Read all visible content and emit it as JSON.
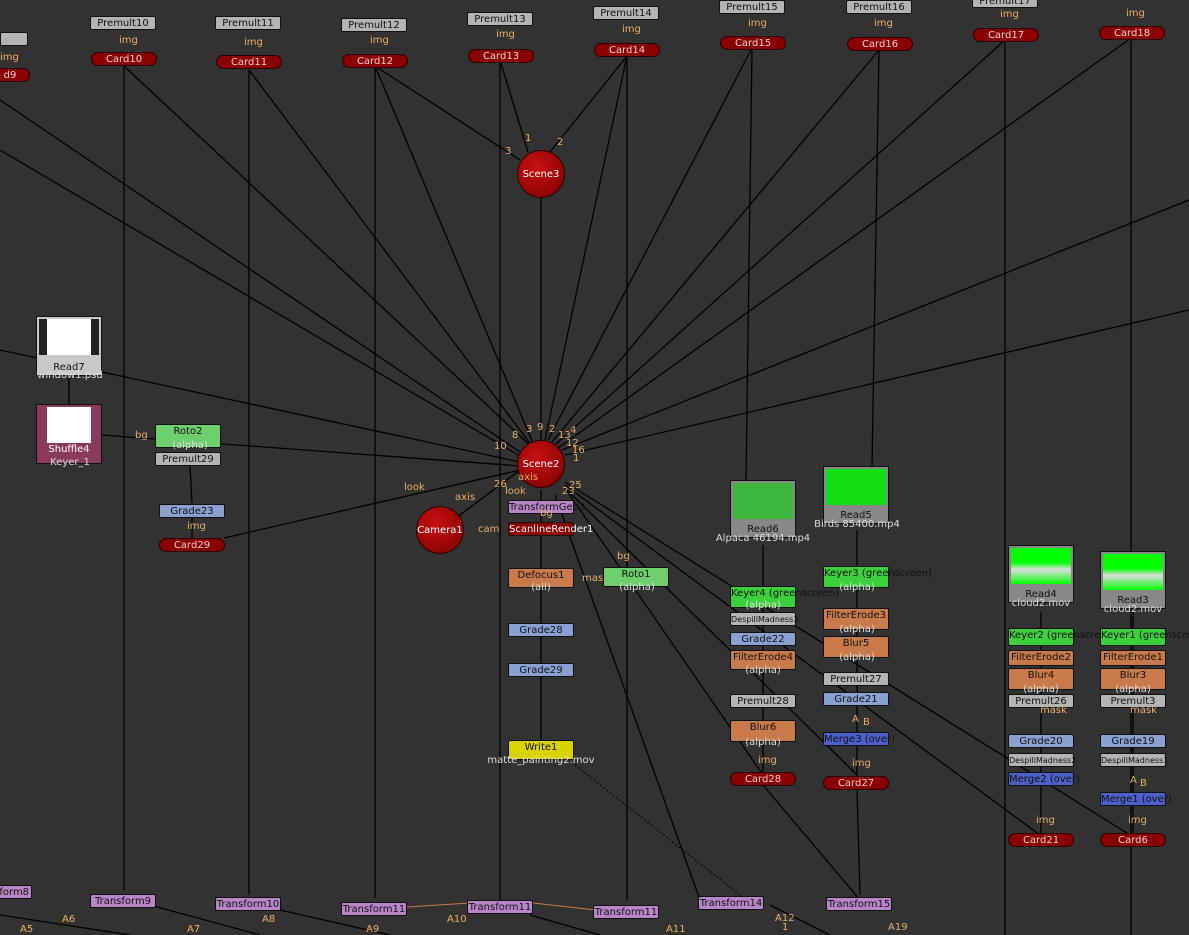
{
  "colors": {
    "background": "#323232",
    "card": "#8b0000",
    "premult": "#b4b4b4",
    "keyer": "#3cd13c",
    "filter": "#c97a4a",
    "grade": "#8aa0d0",
    "merge": "#4d5fc8",
    "transform": "#b886c8",
    "write": "#d9d400",
    "labels": "#e8b060"
  },
  "premults": [
    "Premult10",
    "Premult11",
    "Premult12",
    "Premult13",
    "Premult14",
    "Premult15",
    "Premult16",
    "Premult17"
  ],
  "img_label": "img",
  "cards": [
    "Card10",
    "Card11",
    "Card12",
    "Card13",
    "Card14",
    "Card15",
    "Card16",
    "Card17",
    "Card18",
    "Card29",
    "Card28",
    "Card27",
    "Card21",
    "Card6",
    "d9"
  ],
  "scenes": {
    "scene3": "Scene3",
    "scene2": "Scene2",
    "camera": "Camera1"
  },
  "scene3_inputs": [
    "1",
    "2",
    "3"
  ],
  "scene2_inputs": [
    "10",
    "8",
    "3",
    "9",
    "2",
    "13",
    "12",
    "4",
    "16",
    "1",
    "26",
    "23",
    "25"
  ],
  "left": {
    "read7": "Read7",
    "read7_file": "window1.psd",
    "shuffle": "Shuffle4",
    "shuffle_sub": "Keyer_1",
    "roto2": "Roto2",
    "roto2_sub": "(alpha)",
    "premult29": "Premult29",
    "grade23": "Grade23",
    "bg": "bg"
  },
  "center": {
    "transform_geo": "TransformGeo2",
    "scanline": "ScanlineRender1",
    "defocus": "Defocus1",
    "defocus_sub": "(all)",
    "roto1": "Roto1",
    "roto1_sub": "(alpha)",
    "grade28": "Grade28",
    "grade29": "Grade29",
    "write": "Write1",
    "write_file": "matte_painting2.mov",
    "look": "look",
    "axis": "axis",
    "cam": "cam",
    "bg": "bg",
    "mask": "mask"
  },
  "alpaca": {
    "read": "Read6",
    "file": "Alpaca 46194.mp4",
    "keyer": "Keyer4 (greenscreen)",
    "keyer_sub": "(alpha)",
    "despill": "DespillMadness3",
    "grade": "Grade22",
    "erode": "FilterErode4",
    "erode_sub": "(alpha)",
    "premult": "Premult28",
    "blur": "Blur6",
    "blur_sub": "(alpha)"
  },
  "birds": {
    "read": "Read5",
    "file": "Birds 85400.mp4",
    "keyer": "Keyer3 (greenscreen)",
    "keyer_sub": "(alpha)",
    "erode": "FilterErode3",
    "erode_sub": "(alpha)",
    "blur": "Blur5",
    "blur_sub": "(alpha)",
    "premult": "Premult27",
    "grade": "Grade21",
    "merge": "Merge3 (over)",
    "a": "A",
    "b": "B"
  },
  "cloud2": {
    "read": "Read4",
    "file": "cloud2.mov",
    "keyer": "Keyer2 (greenscreen)",
    "erode": "FilterErode2",
    "blur": "Blur4",
    "blur_sub": "(alpha)",
    "premult": "Premult26",
    "mask": "mask",
    "grade": "Grade20",
    "despill": "DespillMadness2",
    "merge": "Merge2 (over)"
  },
  "cloud1": {
    "read": "Read3",
    "file": "cloud2.mov",
    "keyer": "Keyer1 (greenscreen)",
    "erode": "FilterErode1",
    "blur": "Blur3",
    "blur_sub": "(alpha)",
    "premult": "Premult3",
    "mask": "mask",
    "grade": "Grade19",
    "despill": "DespillMadness1",
    "merge": "Merge1 (over)",
    "a": "A",
    "b": "B"
  },
  "transforms": [
    "Transform8",
    "Transform9",
    "Transform10",
    "Transform11",
    "Transform11",
    "Transform11",
    "Transform14",
    "Transform15"
  ],
  "bottom_labels": [
    "A5",
    "A6",
    "A7",
    "A8",
    "A9",
    "A10",
    "A11",
    "A12",
    "A19",
    "1"
  ]
}
